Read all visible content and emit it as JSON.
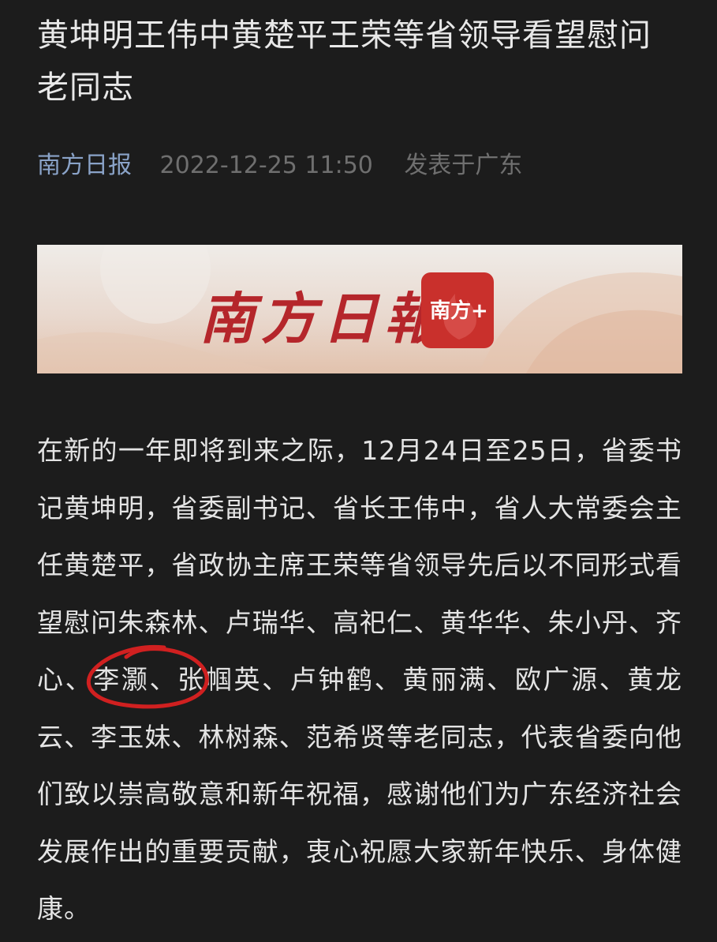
{
  "article": {
    "title": "黄坤明王伟中黄楚平王荣等省领导看望慰问老同志",
    "source": "南方日报",
    "datetime": "2022-12-25 11:50",
    "location": "发表于广东",
    "banner": {
      "logo_text": "南方日報",
      "app_badge": "南方+",
      "logo_color": "#b5262b"
    },
    "body": "在新的一年即将到来之际，12月24日至25日，省委书记黄坤明，省委副书记、省长王伟中，省人大常委会主任黄楚平，省政协主席王荣等省领导先后以不同形式看望慰问朱森林、卢瑞华、高祀仁、黄华华、朱小丹、齐心、李灏、张帼英、卢钟鹤、黄丽满、欧广源、黄龙云、李玉妹、林树森、范希贤等老同志，代表省委向他们致以崇高敬意和新年祝福，感谢他们为广东经济社会发展作出的重要贡献，衷心祝愿大家新年快乐、身体健康。"
  },
  "colors": {
    "background": "#1c1c1c",
    "text": "#e4e4e4",
    "source_link": "#8aa3c8",
    "meta_gray": "#6f6f6f",
    "annotation_red": "#d02020"
  }
}
